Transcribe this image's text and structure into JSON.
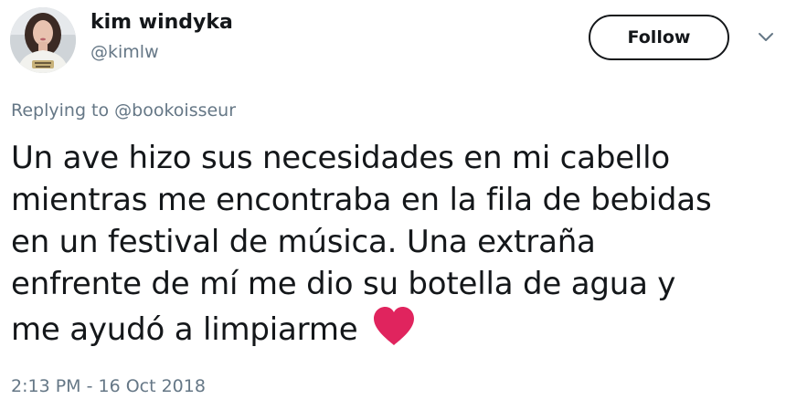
{
  "author": {
    "name": "kim windyka",
    "handle": "@kimlw",
    "avatar_icon": "profile-photo"
  },
  "actions": {
    "follow_label": "Follow",
    "more_icon": "chevron-down-icon"
  },
  "reply": {
    "prefix": "Replying to ",
    "mention": "@bookoisseur"
  },
  "tweet": {
    "lines": [
      "Un ave hizo sus necesidades en mi cabello",
      "mientras me encontraba en la fila de bebidas",
      "en un festival de música. Una extraña",
      "enfrente de mí me dio su botella de agua y",
      "me ayudó a limpiarme"
    ],
    "emoji": "heart-icon",
    "emoji_color": "#e0245e"
  },
  "meta": {
    "timestamp": "2:13 PM - 16 Oct 2018"
  },
  "colors": {
    "text": "#14171a",
    "secondary": "#657786",
    "background": "#ffffff"
  }
}
